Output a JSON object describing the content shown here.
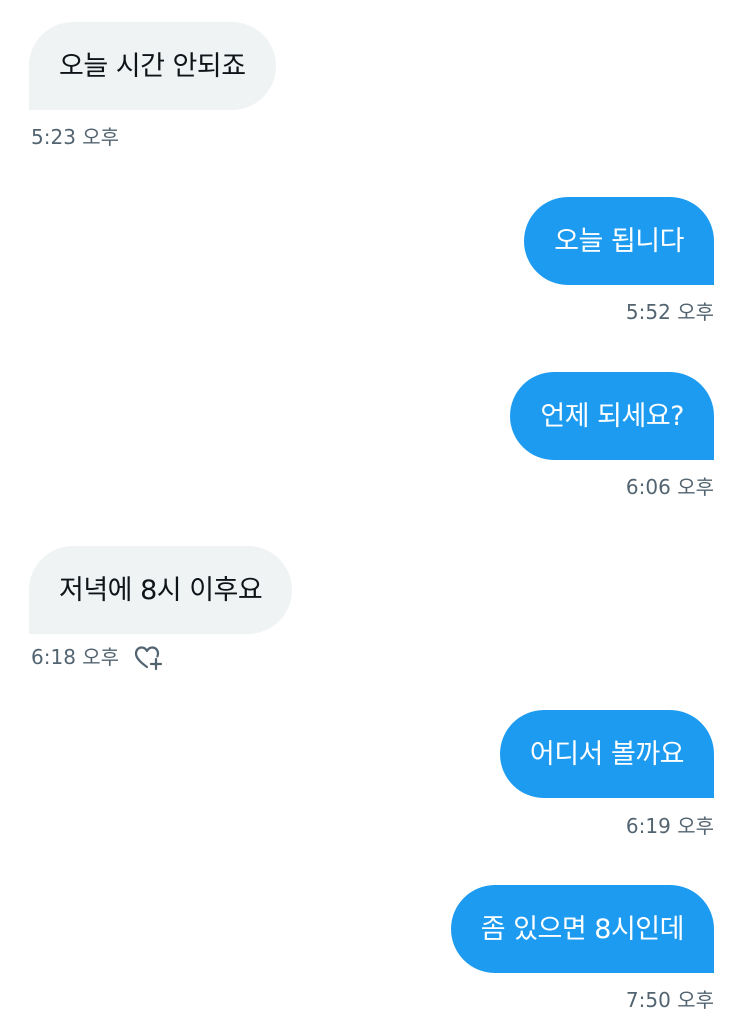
{
  "messages": [
    {
      "text": "오늘 시간 안되죠",
      "time": "5:23 오후",
      "direction": "received"
    },
    {
      "text": "오늘 됩니다",
      "time": "5:52 오후",
      "direction": "sent"
    },
    {
      "text": "언제 되세요?",
      "time": "6:06 오후",
      "direction": "sent"
    },
    {
      "text": "저녁에 8시 이후요",
      "time": "6:18 오후",
      "direction": "received",
      "reaction_icon": "heart-plus-icon"
    },
    {
      "text": "어디서 볼까요",
      "time": "6:19 오후",
      "direction": "sent"
    },
    {
      "text": "좀 있으면 8시인데",
      "time": "7:50 오후",
      "direction": "sent"
    }
  ],
  "colors": {
    "sent_bubble": "#1d9bf0",
    "received_bubble": "#eff3f4",
    "timestamp": "#536471"
  }
}
